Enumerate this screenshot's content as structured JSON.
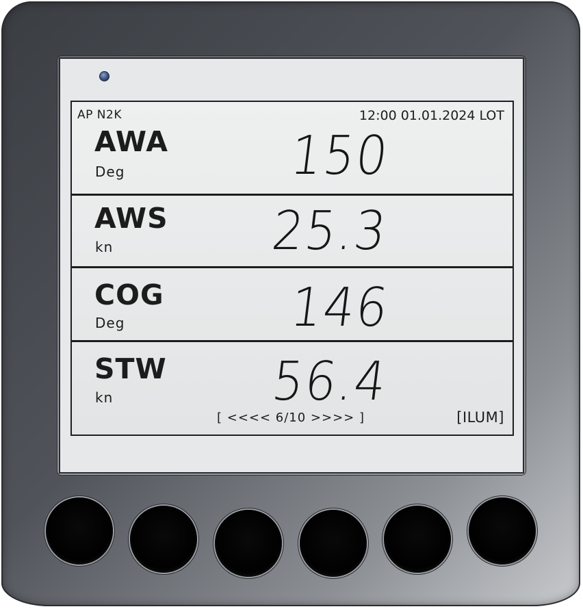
{
  "status_bar": {
    "left": "AP N2K",
    "right": "12:00 01.01.2024 LOT"
  },
  "rows": [
    {
      "label": "AWA",
      "unit": "Deg",
      "value": "150"
    },
    {
      "label": "AWS",
      "unit": "kn",
      "value": "25.3"
    },
    {
      "label": "COG",
      "unit": "Deg",
      "value": "146"
    },
    {
      "label": "STW",
      "unit": "kn",
      "value": "56.4"
    }
  ],
  "footer": {
    "pager": "[ <<<< 6/10 >>>> ]",
    "ilum": "[ILUM]"
  },
  "buttons": [
    "",
    "",
    "",
    "",
    "",
    ""
  ],
  "colors": {
    "lcd_background": "#e6e8e9",
    "lcd_ink": "#1c1c1c",
    "housing": "#4a4e54",
    "led": "#3a4f80"
  }
}
